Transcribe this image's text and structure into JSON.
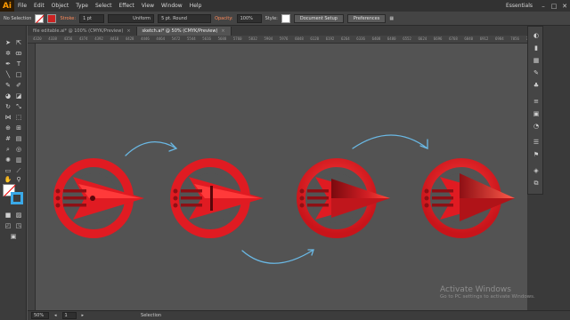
{
  "app": {
    "logo": "Ai",
    "workspace": "Essentials"
  },
  "menu": [
    "File",
    "Edit",
    "Object",
    "Type",
    "Select",
    "Effect",
    "View",
    "Window",
    "Help"
  ],
  "window_controls": [
    "–",
    "□",
    "✕"
  ],
  "control_bar": {
    "selection_label": "No Selection",
    "stroke_label": "Stroke:",
    "stroke_weight": "1 pt",
    "stroke_profile": "Uniform",
    "brush": "5 pt. Round",
    "opacity_label": "Opacity:",
    "opacity_value": "100%",
    "style_label": "Style:",
    "document_setup": "Document Setup",
    "preferences": "Preferences"
  },
  "tabs": [
    {
      "label": "file editable.ai* @ 100% (CMYK/Preview)",
      "close": "×",
      "active": false
    },
    {
      "label": "sketch.ai* @ 50% (CMYK/Preview)",
      "close": "×",
      "active": true
    }
  ],
  "ruler_ticks": [
    "4320",
    "4338",
    "4356",
    "4374",
    "4392",
    "4410",
    "4428",
    "4446",
    "4464",
    "5472",
    "5544",
    "5616",
    "5688",
    "5760",
    "5832",
    "5904",
    "5976",
    "6048",
    "6120",
    "6192",
    "6264",
    "6336",
    "6408",
    "6480",
    "6552",
    "6624",
    "6696",
    "6768",
    "6840",
    "6912",
    "6984",
    "7056",
    "7128"
  ],
  "status": {
    "zoom": "50%",
    "page": "1",
    "tool": "Selection"
  },
  "watermark": {
    "title": "Activate Windows",
    "subtitle": "Go to PC settings to activate Windows."
  },
  "colors": {
    "red": "#e01b22",
    "dark_red": "#8e0f14",
    "arrow_blue": "#6ab8e4",
    "stroke_blue": "#3aa9e8"
  }
}
